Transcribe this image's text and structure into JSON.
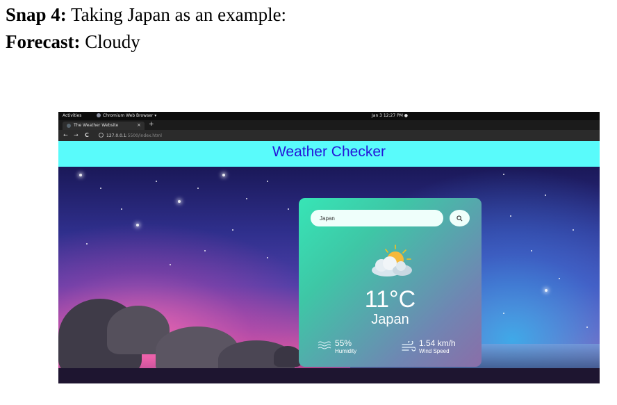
{
  "caption": {
    "line1_bold": "Snap 4:",
    "line1_text": " Taking Japan as an example:",
    "line2_bold": "Forecast:",
    "line2_text": " Cloudy"
  },
  "topbar": {
    "activities": "Activities",
    "app": "Chromium Web Browser ▾",
    "clock": "Jan 3  12:27 PM  ●"
  },
  "browser": {
    "tab_title": "The Weather Website",
    "tab_close": "×",
    "new_tab": "+",
    "url_host": "127.0.0.1",
    "url_path": ":5500/index.html",
    "back": "←",
    "forward": "→",
    "reload": "C"
  },
  "page": {
    "header_title": "Weather Checker",
    "search_value": "Japan",
    "weather_icon": "cloudy-sun-icon",
    "temperature": "11°C",
    "city": "Japan",
    "humidity_value": "55%",
    "humidity_label": "Humidity",
    "wind_value": "1.54 km/h",
    "wind_label": "Wind Speed"
  },
  "colors": {
    "header_bg": "#59fbfb",
    "header_text": "#2516d9",
    "card_gradient_start": "#37e5b6",
    "card_gradient_end": "#8a6ea8"
  }
}
